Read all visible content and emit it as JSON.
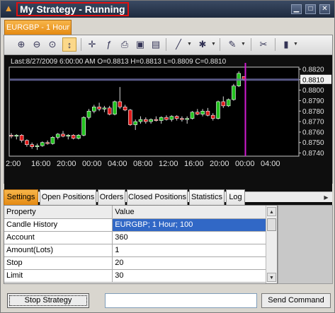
{
  "window": {
    "title": "My Strategy - Running",
    "min_label": "▁",
    "max_label": "□",
    "close_label": "✕"
  },
  "chart_tab": {
    "label": "EURGBP - 1 Hour"
  },
  "chart_info": "Last:8/27/2009 6:00:00 AM O=0.8813 H=0.8813 L=0.8809 C=0.8810",
  "chart_data": {
    "type": "candlestick",
    "symbol": "EURGBP",
    "timeframe": "1 Hour",
    "y_ticks": [
      "0.8820",
      "0.8810",
      "0.8800",
      "0.8790",
      "0.8780",
      "0.8770",
      "0.8760",
      "0.8750",
      "0.8740"
    ],
    "ylim": [
      0.8737,
      0.8822
    ],
    "current_price": "0.8810",
    "x_ticks": [
      "2:00",
      "16:00",
      "20:00",
      "00:00",
      "04:00",
      "08:00",
      "12:00",
      "16:00",
      "20:00",
      "00:00",
      "04:00"
    ],
    "candles": [
      [
        0.8757,
        0.8759,
        0.8754,
        0.8756
      ],
      [
        0.8756,
        0.8758,
        0.8753,
        0.8757
      ],
      [
        0.8757,
        0.8758,
        0.875,
        0.8752
      ],
      [
        0.8752,
        0.8753,
        0.8746,
        0.8748
      ],
      [
        0.8748,
        0.875,
        0.8744,
        0.8746
      ],
      [
        0.8746,
        0.8749,
        0.8743,
        0.8747
      ],
      [
        0.8747,
        0.8751,
        0.8746,
        0.875
      ],
      [
        0.875,
        0.8752,
        0.8748,
        0.8749
      ],
      [
        0.8749,
        0.8756,
        0.8748,
        0.8755
      ],
      [
        0.8755,
        0.8759,
        0.8753,
        0.8758
      ],
      [
        0.8758,
        0.8761,
        0.8755,
        0.8756
      ],
      [
        0.8756,
        0.8758,
        0.8753,
        0.8757
      ],
      [
        0.8757,
        0.8758,
        0.8753,
        0.8754
      ],
      [
        0.8754,
        0.8758,
        0.8753,
        0.8757
      ],
      [
        0.8757,
        0.8775,
        0.8756,
        0.8774
      ],
      [
        0.8774,
        0.8782,
        0.8772,
        0.878
      ],
      [
        0.878,
        0.8786,
        0.8778,
        0.8784
      ],
      [
        0.8784,
        0.8788,
        0.878,
        0.8782
      ],
      [
        0.8782,
        0.8785,
        0.8779,
        0.8783
      ],
      [
        0.8783,
        0.8785,
        0.8776,
        0.8777
      ],
      [
        0.8777,
        0.879,
        0.8776,
        0.8789
      ],
      [
        0.8789,
        0.8803,
        0.8782,
        0.8784
      ],
      [
        0.8784,
        0.8786,
        0.878,
        0.8781
      ],
      [
        0.8781,
        0.8782,
        0.8766,
        0.8767
      ],
      [
        0.8767,
        0.8772,
        0.8762,
        0.877
      ],
      [
        0.877,
        0.8775,
        0.8768,
        0.8772
      ],
      [
        0.8772,
        0.8774,
        0.8768,
        0.877
      ],
      [
        0.877,
        0.8773,
        0.8768,
        0.8772
      ],
      [
        0.8772,
        0.8775,
        0.877,
        0.8771
      ],
      [
        0.8771,
        0.8775,
        0.8768,
        0.8774
      ],
      [
        0.8774,
        0.8776,
        0.8771,
        0.8772
      ],
      [
        0.8772,
        0.8776,
        0.877,
        0.8775
      ],
      [
        0.8775,
        0.8776,
        0.8771,
        0.8773
      ],
      [
        0.8773,
        0.8775,
        0.877,
        0.8772
      ],
      [
        0.8772,
        0.8775,
        0.8768,
        0.8773
      ],
      [
        0.8773,
        0.878,
        0.8772,
        0.8779
      ],
      [
        0.8779,
        0.8782,
        0.8776,
        0.8777
      ],
      [
        0.8777,
        0.8782,
        0.8775,
        0.878
      ],
      [
        0.878,
        0.8783,
        0.8775,
        0.8776
      ],
      [
        0.8776,
        0.8778,
        0.8771,
        0.8773
      ],
      [
        0.8773,
        0.879,
        0.8772,
        0.8789
      ],
      [
        0.8789,
        0.8794,
        0.8783,
        0.8785
      ],
      [
        0.8785,
        0.8792,
        0.8784,
        0.8791
      ],
      [
        0.8791,
        0.8806,
        0.879,
        0.8804
      ],
      [
        0.8804,
        0.8818,
        0.8803,
        0.8816
      ],
      [
        0.8813,
        0.8813,
        0.8809,
        0.881
      ]
    ]
  },
  "bottom_tabs": [
    {
      "label": "Settings",
      "active": true
    },
    {
      "label": "Open Positions",
      "active": false
    },
    {
      "label": "Orders",
      "active": false
    },
    {
      "label": "Closed Positions",
      "active": false
    },
    {
      "label": "Statistics",
      "active": false
    },
    {
      "label": "Log",
      "active": false
    }
  ],
  "settings_table": {
    "headers": [
      "Property",
      "Value"
    ],
    "rows": [
      [
        "Candle History",
        "EURGBP; 1 Hour; 100"
      ],
      [
        "Account",
        "360"
      ],
      [
        "Amount(Lots)",
        "1"
      ],
      [
        "Stop",
        "20"
      ],
      [
        "Limit",
        "30"
      ]
    ],
    "selected_row": 0
  },
  "footer": {
    "stop_label": "Stop Strategy",
    "command_value": "",
    "send_label": "Send Command"
  },
  "colors": {
    "bull": "#22c21e",
    "bear": "#e01919",
    "marker_line": "#d21bd2",
    "price_line": "#6e6ea8",
    "tab_accent": "#f0a030"
  }
}
